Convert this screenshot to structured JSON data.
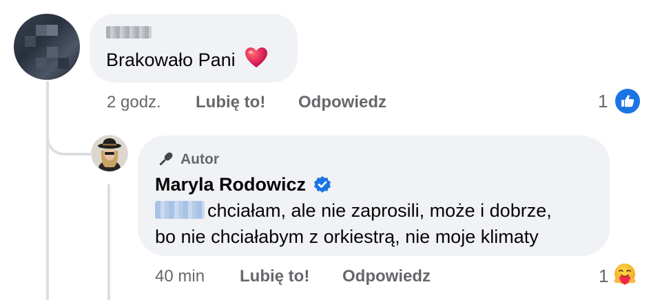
{
  "comment": {
    "text": "Brakowało Pani",
    "emoji": "❤️",
    "time": "2 godz.",
    "like_label": "Lubię to!",
    "reply_label": "Odpowiedz",
    "reaction_count": "1",
    "reaction_icon": "like-thumb-icon"
  },
  "reply": {
    "role_label": "Autor",
    "role_icon": "microphone-icon",
    "author": "Maryla Rodowicz",
    "verified_icon": "verified-badge-icon",
    "line1": "chciałam, ale nie zaprosili, może i dobrze,",
    "line2": "bo nie chciałabym z orkiestrą, nie moje klimaty",
    "time": "40 min",
    "like_label": "Lubię to!",
    "reply_label": "Odpowiedz",
    "reaction_count": "1",
    "reaction_icon": "care-reaction-icon"
  },
  "colors": {
    "bubble": "#f0f2f5",
    "meta_text": "#65676b",
    "like_blue": "#1b74e4",
    "heart_red": "#e0245e"
  }
}
